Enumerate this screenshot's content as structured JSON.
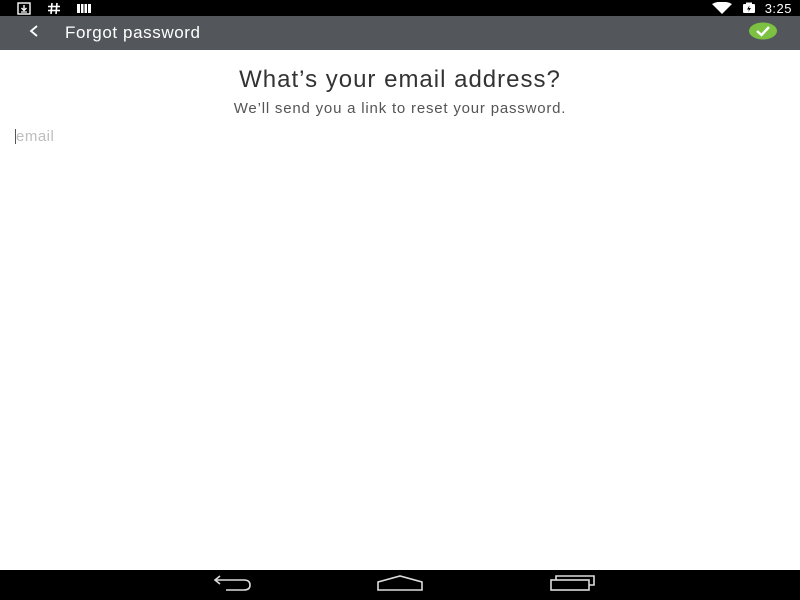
{
  "status_bar": {
    "time": "3:25",
    "left_icons": [
      "download-icon",
      "hash-icon",
      "storage-icon"
    ],
    "right_icons": [
      "wifi-icon",
      "battery-icon"
    ]
  },
  "action_bar": {
    "title": "Forgot password",
    "back_icon": "chevron-left-icon",
    "confirm_icon": "check-circle-icon",
    "confirm_color": "#7cc142",
    "background_color": "#53575b"
  },
  "content": {
    "heading": "What’s your email address?",
    "subheading": "We’ll send you a link to reset your password.",
    "email_field": {
      "value": "",
      "placeholder": "email"
    }
  },
  "nav_bar": {
    "items": [
      "back-icon",
      "home-icon",
      "recents-icon"
    ]
  }
}
